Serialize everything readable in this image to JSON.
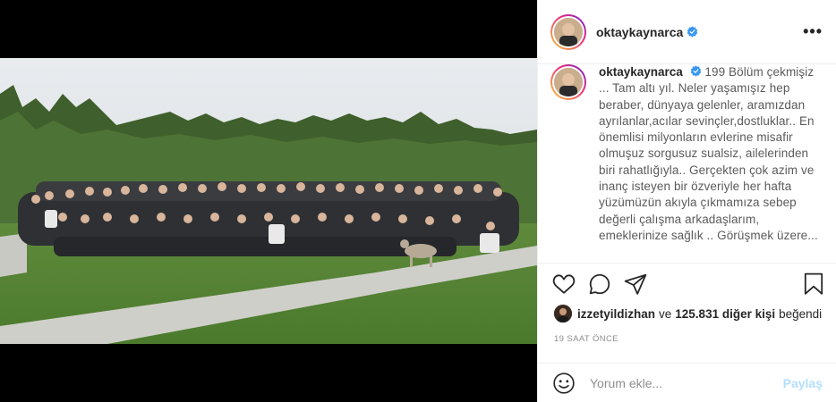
{
  "post": {
    "username": "oktaykaynarca",
    "verified": true,
    "more_icon": "more-horizontal-icon"
  },
  "caption": {
    "username": "oktaykaynarca",
    "text": "199 Bölüm çekmişiz ... Tam altı yıl. Neler yaşamışız hep beraber, dünyaya gelenler, aramızdan ayrılanlar,acılar sevinçler,dostluklar.. En önemlisi milyonların evlerine misafir olmuşuz sorgusuz sualsiz, ailelerinden biri rahatlığıyla.. Gerçekten çok azim ve inanç isteyen bir özveriyle her hafta yüzümüzün akıyla çıkmamıza sebep değerli çalışma arkadaşlarım, emeklerinize sağlık .. Görüşmek üzere..."
  },
  "actions": {
    "like_icon": "heart-icon",
    "comment_icon": "comment-icon",
    "share_icon": "paper-plane-icon",
    "save_icon": "bookmark-icon"
  },
  "likes": {
    "user": "izzetyildizhan",
    "conjunction": "ve",
    "count_text": "125.831 diğer kişi",
    "suffix": "beğendi"
  },
  "timestamp": "19 SAAT ÖNCE",
  "comment_box": {
    "placeholder": "Yorum ekle...",
    "post_label": "Paylaş",
    "emoji_icon": "smiley-icon"
  },
  "colors": {
    "verified_blue": "#3897f0",
    "post_disabled": "#b2dffc",
    "secondary_text": "#8e8e8e"
  }
}
